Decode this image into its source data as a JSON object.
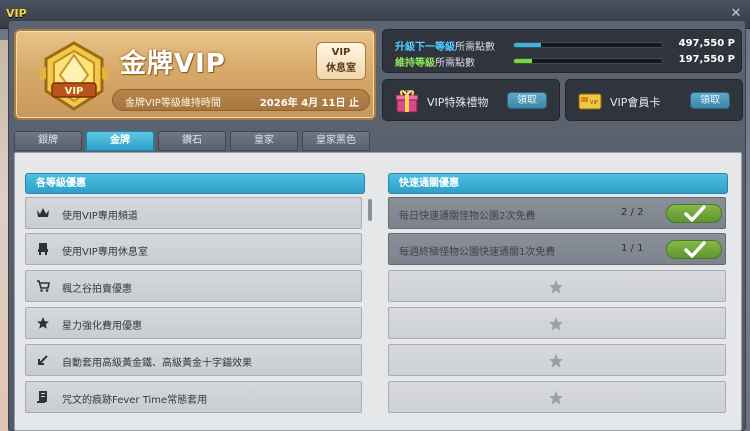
{
  "window": {
    "title": "VIP",
    "close_icon": "close-icon"
  },
  "header": {
    "tier_title": "金牌VIP",
    "lounge_button": {
      "line1": "VIP",
      "line2": "休息室"
    },
    "maintain_label": "金牌VIP等級維持時間",
    "maintain_date": "2026年 4月 11日 止"
  },
  "progress": {
    "upgrade": {
      "label_strong": "升級下一等級",
      "label_rest": "所需點數",
      "fill_fraction": 0.18,
      "value": "497,550 P",
      "color": "#36b6e6"
    },
    "maintain": {
      "label_strong": "維持等級",
      "label_rest": "所需點數",
      "fill_fraction": 0.12,
      "value": "197,550 P",
      "color": "#7ad83a"
    }
  },
  "gifts": [
    {
      "label": "VIP特殊禮物",
      "button": "領取",
      "icon": "gift-icon"
    },
    {
      "label": "VIP會員卡",
      "button": "領取",
      "icon": "card-icon"
    }
  ],
  "tabs": [
    {
      "label": "銀牌",
      "active": false
    },
    {
      "label": "金牌",
      "active": true
    },
    {
      "label": "鑽石",
      "active": false
    },
    {
      "label": "皇家",
      "active": false
    },
    {
      "label": "皇家黑色",
      "active": false
    }
  ],
  "benefits": {
    "heading": "各等級優惠",
    "items": [
      {
        "icon": "crown-icon",
        "text": "使用VIP專用頻道"
      },
      {
        "icon": "chair-icon",
        "text": "使用VIP專用休息室"
      },
      {
        "icon": "cart-icon",
        "text": "楓之谷拍賣優惠"
      },
      {
        "icon": "star-icon",
        "text": "星力強化費用優惠"
      },
      {
        "icon": "arrow-icon",
        "text": "自動套用高級黃金鐵、高級黃金十字錨效果"
      },
      {
        "icon": "scroll-icon",
        "text": "咒文的痕跡Fever Time常態套用"
      }
    ]
  },
  "quick": {
    "heading": "快速通關優惠",
    "items": [
      {
        "text": "每日快速通關怪物公園2次免費",
        "count": "2 / 2"
      },
      {
        "text": "每週終極怪物公園快速通關1次免費",
        "count": "1 / 1"
      }
    ],
    "empty_slots": 4
  },
  "colors": {
    "accent": "#2ca1cb",
    "gold": "#d8aa6a",
    "check": "#6aa63a"
  }
}
